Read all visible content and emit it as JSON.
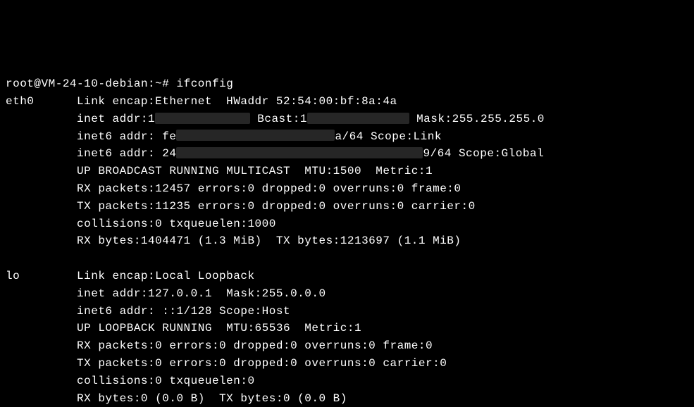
{
  "prompt": {
    "user": "root",
    "host": "VM-24-10-debian",
    "cwd": "~",
    "symbol": "#",
    "command": "ifconfig"
  },
  "eth0": {
    "name": "eth0",
    "link": "Link encap:Ethernet  HWaddr 52:54:00:bf:8a:4a",
    "inet_pre": "inet addr:1",
    "inet_bcast_pre": "Bcast:1",
    "inet_mask": "Mask:255.255.255.0",
    "inet6a_pre": "inet6 addr: fe",
    "inet6a_post": "a/64 Scope:Link",
    "inet6b_pre": "inet6 addr: 24",
    "inet6b_post": "9/64 Scope:Global",
    "flags": "UP BROADCAST RUNNING MULTICAST  MTU:1500  Metric:1",
    "rx": "RX packets:12457 errors:0 dropped:0 overruns:0 frame:0",
    "tx": "TX packets:11235 errors:0 dropped:0 overruns:0 carrier:0",
    "coll": "collisions:0 txqueuelen:1000",
    "bytes": "RX bytes:1404471 (1.3 MiB)  TX bytes:1213697 (1.1 MiB)"
  },
  "lo": {
    "name": "lo",
    "link": "Link encap:Local Loopback",
    "inet": "inet addr:127.0.0.1  Mask:255.0.0.0",
    "inet6": "inet6 addr: ::1/128 Scope:Host",
    "flags": "UP LOOPBACK RUNNING  MTU:65536  Metric:1",
    "rx": "RX packets:0 errors:0 dropped:0 overruns:0 frame:0",
    "tx": "TX packets:0 errors:0 dropped:0 overruns:0 carrier:0",
    "coll": "collisions:0 txqueuelen:0",
    "bytes": "RX bytes:0 (0.0 B)  TX bytes:0 (0.0 B)"
  }
}
